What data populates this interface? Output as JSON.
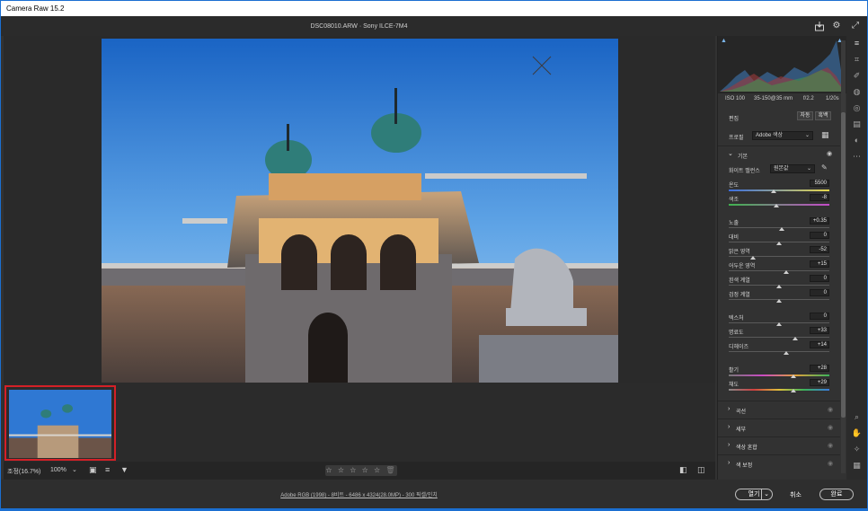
{
  "window": {
    "title": "Camera Raw 15.2"
  },
  "header": {
    "filename": "DSC08010.ARW",
    "separator": "·",
    "camera": "Sony ILCE-7M4"
  },
  "histogram": {
    "iso": "ISO 100",
    "lens": "35-150@35 mm",
    "aperture": "f/2.2",
    "shutter": "1/20s"
  },
  "panel": {
    "edit_label": "편집",
    "auto_label": "자동",
    "bw_label": "흑백",
    "profile_label": "프로필",
    "profile_value": "Adobe 색상",
    "basic_label": "기본",
    "wb_label": "화이트 밸런스",
    "wb_value": "원본값",
    "sliders": [
      {
        "label": "온도",
        "value": "5500",
        "pos": 0.45
      },
      {
        "label": "색조",
        "value": "-8",
        "pos": 0.47
      },
      {
        "label": "노출",
        "value": "+0.35",
        "pos": 0.53
      },
      {
        "label": "대비",
        "value": "0",
        "pos": 0.5
      },
      {
        "label": "밝은 영역",
        "value": "-52",
        "pos": 0.24
      },
      {
        "label": "어두운 영역",
        "value": "+15",
        "pos": 0.57
      },
      {
        "label": "흰색 계열",
        "value": "0",
        "pos": 0.5
      },
      {
        "label": "검정 계열",
        "value": "0",
        "pos": 0.5
      },
      {
        "label": "텍스처",
        "value": "0",
        "pos": 0.5
      },
      {
        "label": "명료도",
        "value": "+33",
        "pos": 0.66
      },
      {
        "label": "디헤이즈",
        "value": "+14",
        "pos": 0.57
      },
      {
        "label": "활기",
        "value": "+28",
        "pos": 0.64
      },
      {
        "label": "채도",
        "value": "+29",
        "pos": 0.64
      }
    ],
    "sections": [
      "곡선",
      "세부",
      "색상 혼합",
      "색 보정"
    ]
  },
  "statusbar": {
    "zoom_label": "조정(16.7%)",
    "zoom_pct": "100%",
    "stars": "☆ ☆ ☆ ☆ ☆"
  },
  "footer": {
    "info": "Adobe RGB (1998) - 8비트 - 6486 x 4324(28.0MP) - 300 픽셀/인치",
    "open_label": "열기",
    "cancel_label": "취소",
    "done_label": "완료"
  },
  "colors": {
    "accent": "#1b6fd1",
    "selection": "#d42027"
  }
}
